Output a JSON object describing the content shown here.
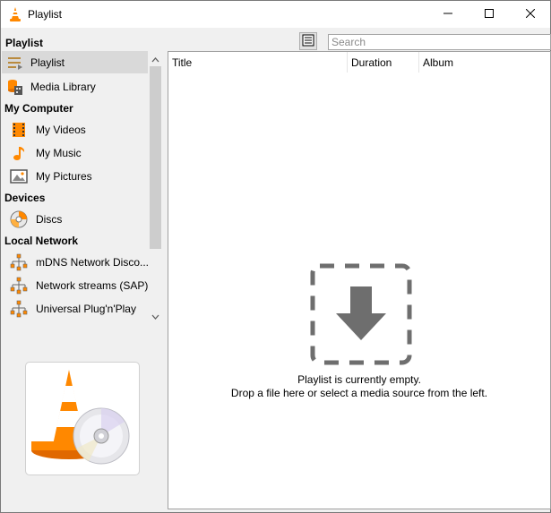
{
  "window": {
    "title": "Playlist"
  },
  "top": {
    "section_label": "Playlist",
    "search_placeholder": "Search"
  },
  "sidebar": {
    "items": [
      {
        "label": "Playlist"
      },
      {
        "label": "Media Library"
      },
      {
        "category": "My Computer"
      },
      {
        "label": "My Videos"
      },
      {
        "label": "My Music"
      },
      {
        "label": "My Pictures"
      },
      {
        "category": "Devices"
      },
      {
        "label": "Discs"
      },
      {
        "category": "Local Network"
      },
      {
        "label": "mDNS Network Disco..."
      },
      {
        "label": "Network streams (SAP)"
      },
      {
        "label": "Universal Plug'n'Play"
      }
    ]
  },
  "table": {
    "columns": [
      "Title",
      "Duration",
      "Album"
    ]
  },
  "empty": {
    "line1": "Playlist is currently empty.",
    "line2": "Drop a file here or select a media source from the left."
  },
  "colors": {
    "accent": "#ff8800",
    "selected_bg": "#d9d9d9"
  }
}
